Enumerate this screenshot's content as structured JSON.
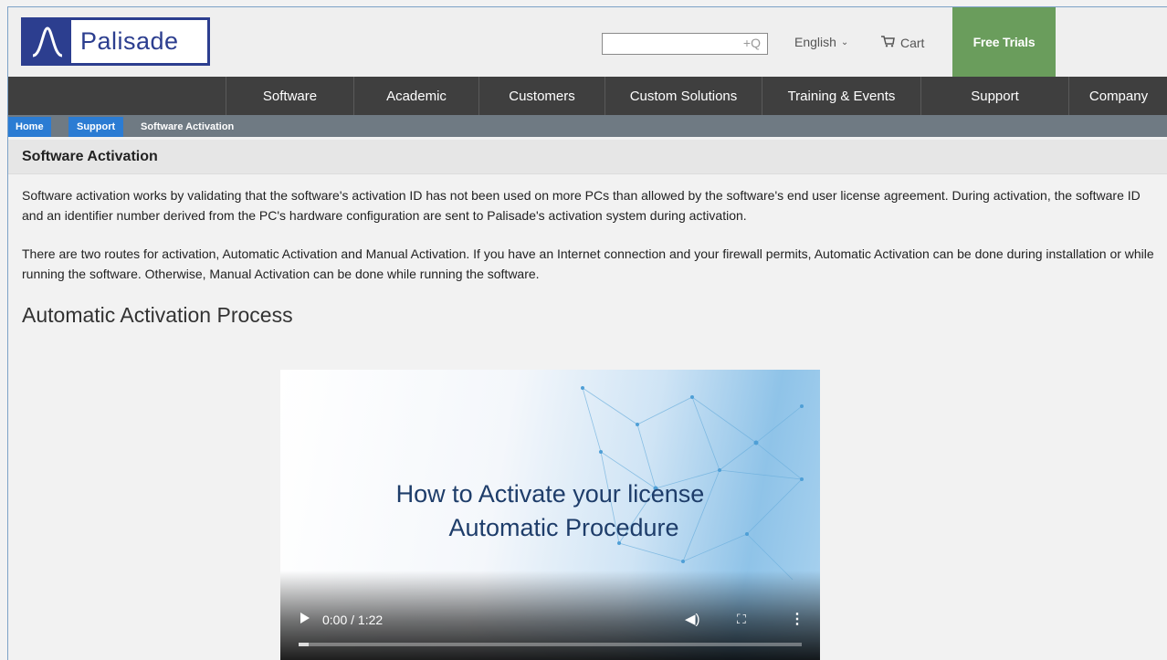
{
  "header": {
    "logo_text": "Palisade",
    "search": {
      "placeholder": "",
      "value": ""
    },
    "language": "English",
    "cart_label": "Cart",
    "free_trials_label": "Free Trials",
    "accent_color": "#6a9d5c",
    "brand_color": "#2c3e8f"
  },
  "nav": {
    "items": [
      {
        "label": "Software"
      },
      {
        "label": "Academic"
      },
      {
        "label": "Customers"
      },
      {
        "label": "Custom Solutions"
      },
      {
        "label": "Training & Events"
      },
      {
        "label": "Support"
      },
      {
        "label": "Company"
      }
    ]
  },
  "breadcrumb": {
    "items": [
      {
        "label": "Home"
      },
      {
        "label": "Support"
      },
      {
        "label": "Software Activation"
      }
    ]
  },
  "page": {
    "title": "Software Activation",
    "paragraphs": [
      "Software activation works by validating that the software's activation ID has not been used on more PCs than allowed by the software's end user license agreement. During activation, the software ID and an identifier number derived from the PC's hardware configuration are sent to Palisade's activation system during activation.",
      "There are two routes for activation, Automatic Activation and Manual Activation. If you have an Internet connection and your firewall permits, Automatic Activation can be done during installation or while running the software. Otherwise, Manual Activation can be done while running the software."
    ],
    "section_heading": "Automatic Activation Process"
  },
  "video": {
    "title_line1": "How to Activate your license",
    "title_line2": "Automatic Procedure",
    "time": "0:00 / 1:22",
    "progress": 0.02,
    "icons": {
      "play": "play-icon",
      "volume": "volume-icon",
      "fullscreen": "fullscreen-icon",
      "more": "more-options-icon"
    }
  }
}
